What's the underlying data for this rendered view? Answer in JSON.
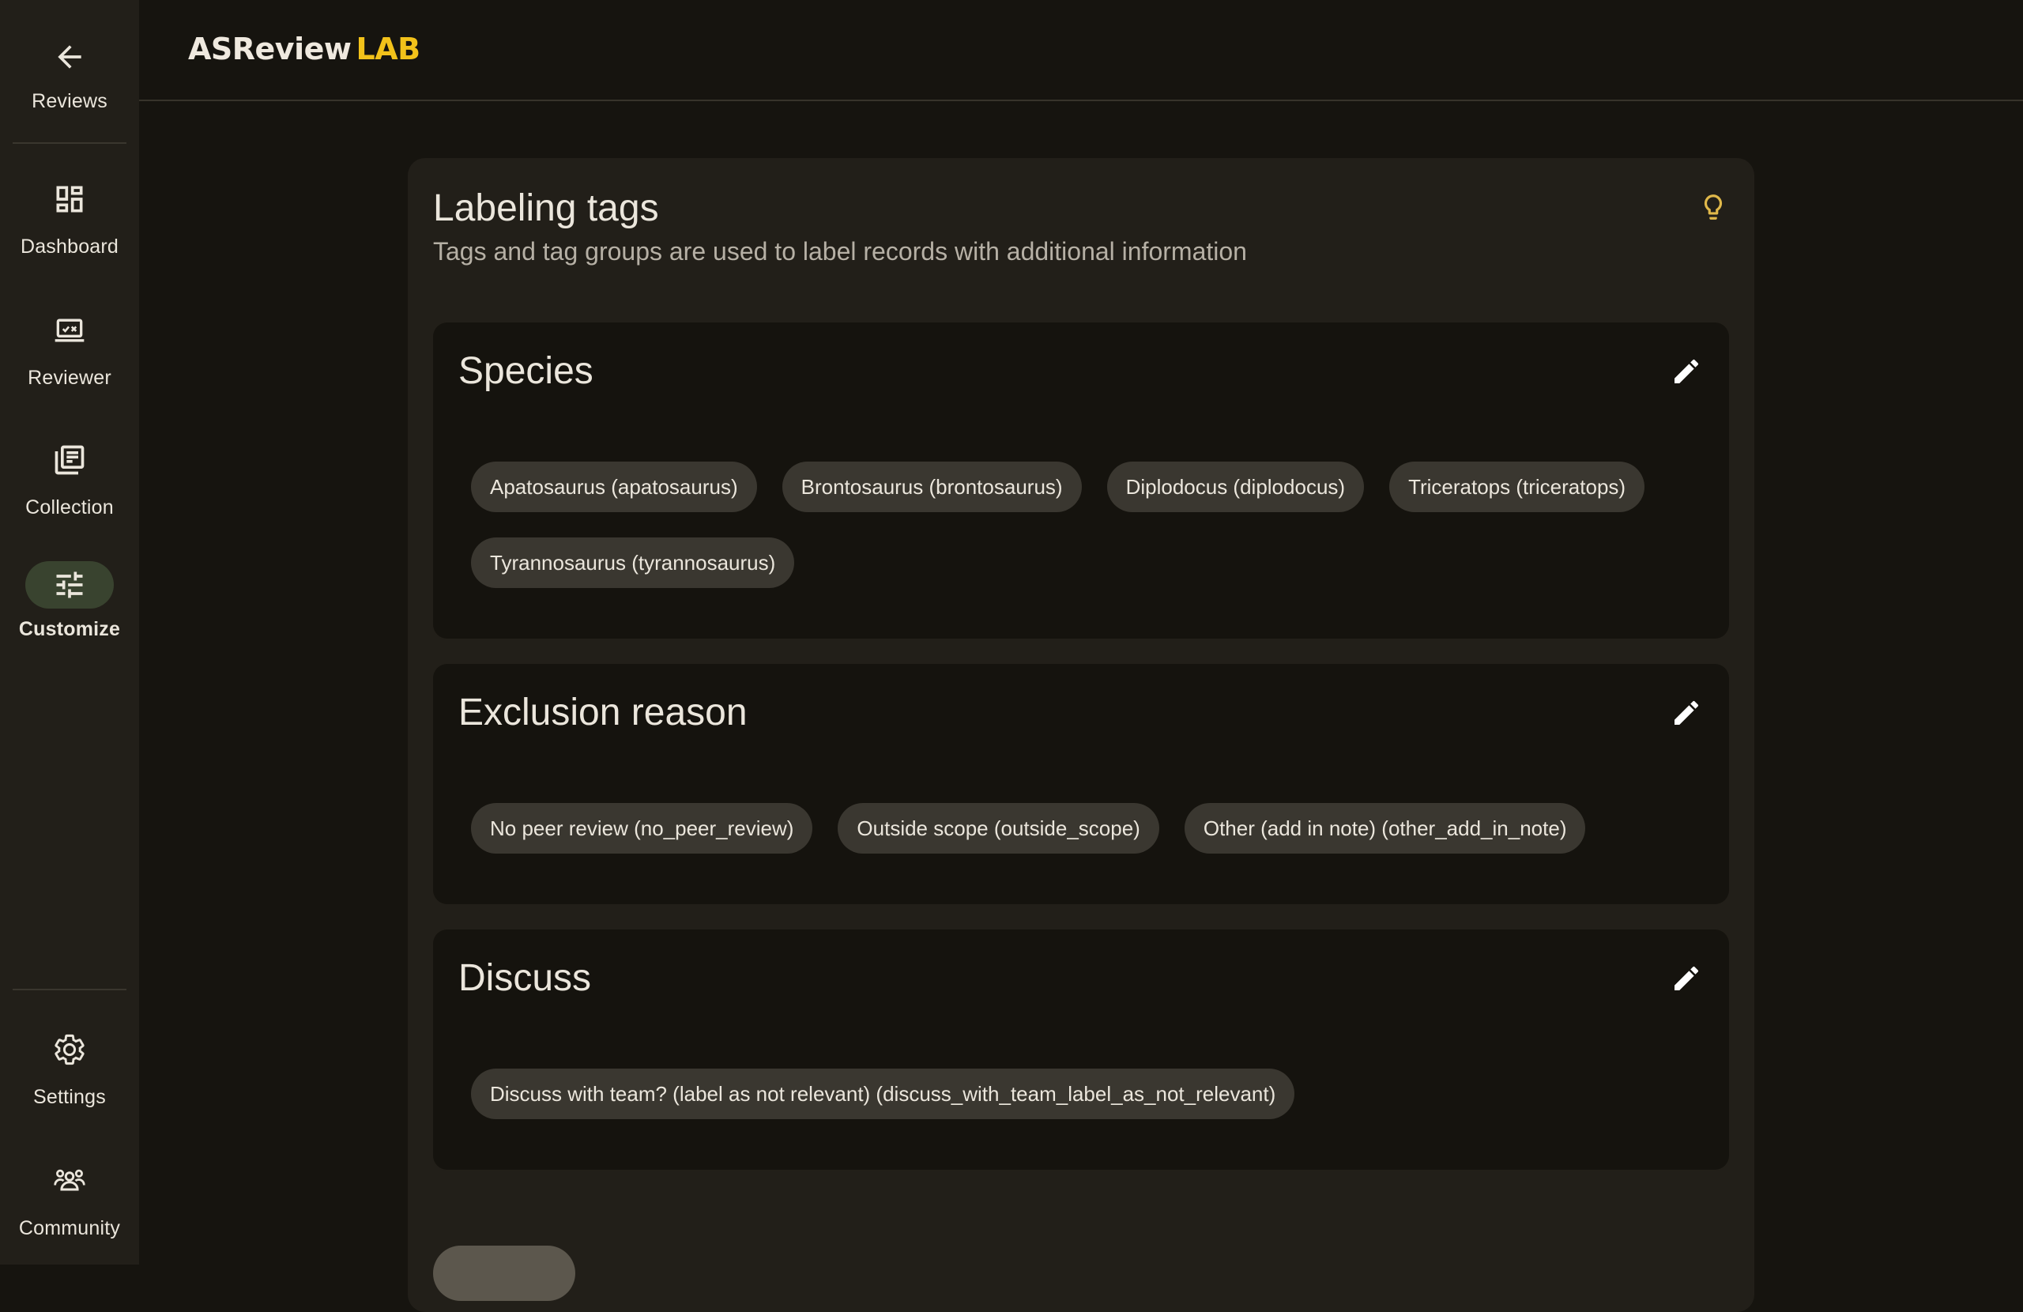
{
  "brand": {
    "primary": "ASReview",
    "accent": "LAB",
    "accent_color": "#f2c21a"
  },
  "sidebar": {
    "top_items": [
      {
        "label": "Reviews",
        "icon": "arrow-left-icon",
        "active": false
      },
      {
        "label": "Dashboard",
        "icon": "dashboard-icon",
        "active": false
      },
      {
        "label": "Reviewer",
        "icon": "reviewer-laptop-icon",
        "active": false
      },
      {
        "label": "Collection",
        "icon": "collection-icon",
        "active": false
      },
      {
        "label": "Customize",
        "icon": "tune-icon",
        "active": true
      }
    ],
    "bottom_items": [
      {
        "label": "Settings",
        "icon": "gear-icon"
      },
      {
        "label": "Community",
        "icon": "community-icon"
      }
    ],
    "active_color": "#39432f"
  },
  "page": {
    "title": "Labeling tags",
    "subtitle": "Tags and tag groups are used to label records with additional information"
  },
  "tag_groups": [
    {
      "name": "Species",
      "tags": [
        "Apatosaurus (apatosaurus)",
        "Brontosaurus (brontosaurus)",
        "Diplodocus (diplodocus)",
        "Triceratops (triceratops)",
        "Tyrannosaurus (tyrannosaurus)"
      ]
    },
    {
      "name": "Exclusion reason",
      "tags": [
        "No peer review (no_peer_review)",
        "Outside scope (outside_scope)",
        "Other (add in note) (other_add_in_note)"
      ]
    },
    {
      "name": "Discuss",
      "tags": [
        "Discuss with team? (label as not relevant) (discuss_with_team_label_as_not_relevant)"
      ]
    }
  ],
  "colors": {
    "background": "#16140f",
    "surface": "#221f19",
    "group_surface": "#15130e",
    "chip": "#3a3730",
    "text": "#ebe6dc"
  }
}
